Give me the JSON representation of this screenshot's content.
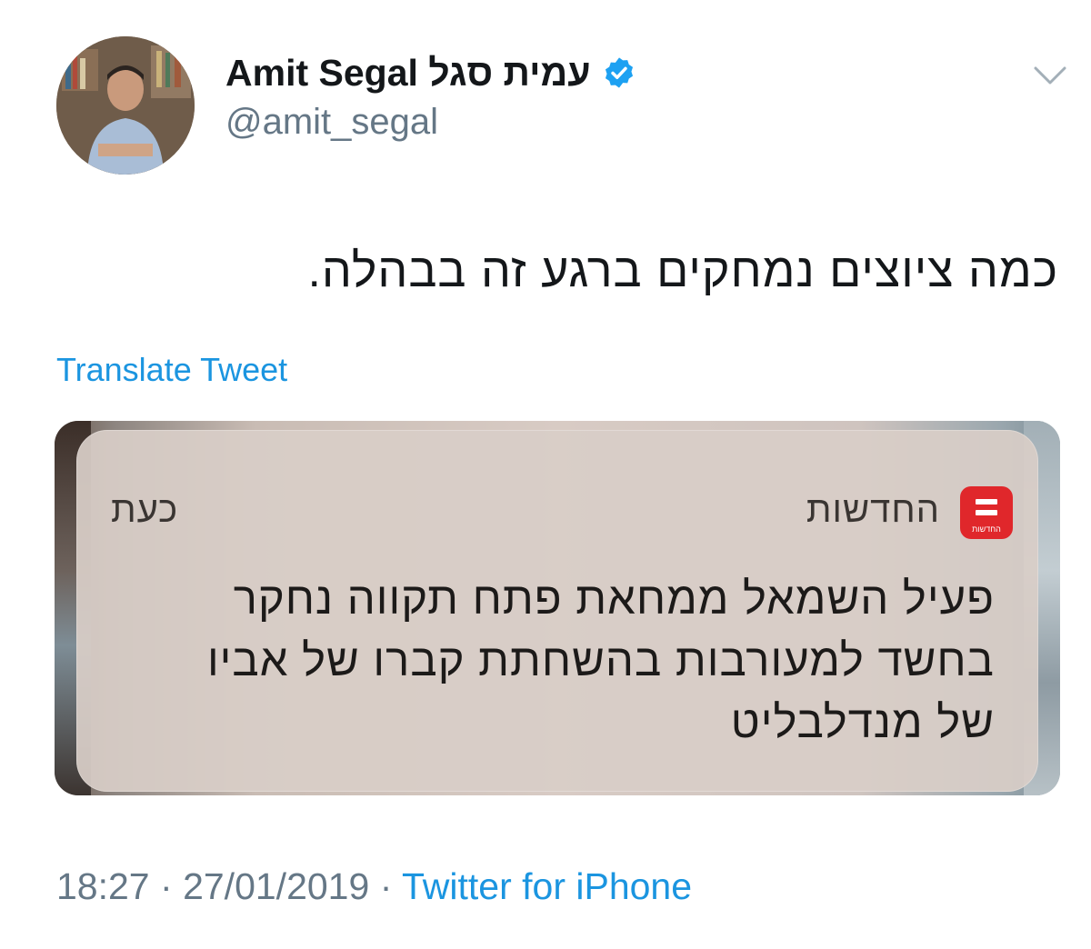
{
  "author": {
    "display_name": "Amit Segal עמית סגל",
    "handle": "@amit_segal",
    "verified": true
  },
  "icons": {
    "avatar": "avatar-photo",
    "verified": "verified-badge-icon",
    "menu": "chevron-down-icon",
    "app": "hahadashot-app-icon"
  },
  "tweet": {
    "text": "כמה ציוצים נמחקים ברגע זה בבהלה.",
    "translate_label": "Translate Tweet"
  },
  "notification": {
    "app_name": "החדשות",
    "app_icon_caption": "החדשות",
    "time": "כעת",
    "body_lines": [
      "פעיל השמאל ממחאת פתח תקווה נחקר",
      "בחשד למעורבות בהשחתת קברו של אביו",
      "של מנדלבליט"
    ]
  },
  "footer": {
    "time": "18:27",
    "separator": "·",
    "date": "27/01/2019",
    "source": "Twitter for iPhone"
  },
  "colors": {
    "link": "#1b95e0",
    "muted": "#657786",
    "text": "#14171a",
    "verified": "#1da1f2",
    "app_icon": "#e0272b"
  }
}
